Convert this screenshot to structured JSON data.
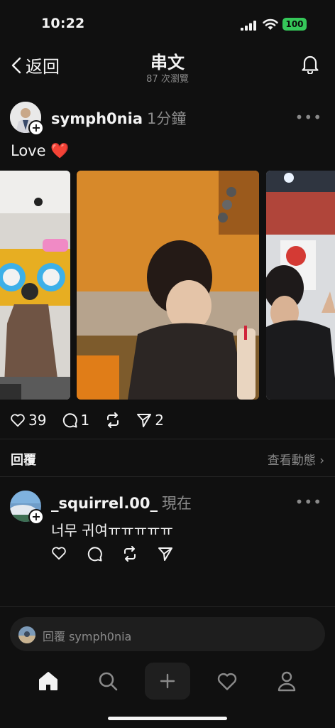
{
  "status": {
    "time": "10:22",
    "battery": "100"
  },
  "nav": {
    "back_label": "返回",
    "title": "串文",
    "views": "87 次瀏覽"
  },
  "post": {
    "username": "symph0nia",
    "time": "1分鐘",
    "caption": "Love",
    "caption_emoji": "❤️",
    "likes": "39",
    "comments": "1",
    "shares": "2"
  },
  "replies_section": {
    "label": "回覆",
    "activity_link": "查看動態 ›"
  },
  "reply": {
    "username": "_squirrel.00_",
    "time": "現在",
    "text": "너무 귀여ㅠㅠㅠㅠㅠ"
  },
  "reply_input": {
    "placeholder": "回覆 symph0nia"
  },
  "colors": {
    "background": "#101010",
    "text": "#f3f3f3",
    "muted": "#8a8a8a",
    "battery": "#35c759",
    "heart": "#e0242f"
  },
  "icons": [
    "back-chevron-icon",
    "bell-icon",
    "more-icon",
    "heart-icon",
    "comment-icon",
    "repost-icon",
    "send-icon",
    "home-icon",
    "search-icon",
    "plus-icon",
    "activity-heart-icon",
    "profile-icon"
  ]
}
